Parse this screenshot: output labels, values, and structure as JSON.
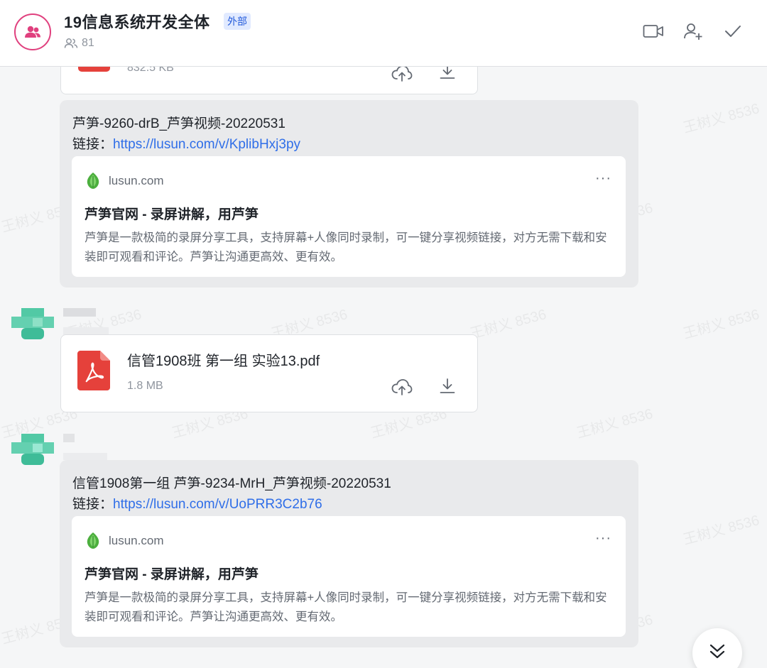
{
  "header": {
    "group_name": "19信息系统开发全体",
    "tag": "外部",
    "member_count": "81"
  },
  "icons": {
    "group_avatar": "group-icon",
    "video_call": "video-camera-icon",
    "add_member": "add-member-icon",
    "done": "checkmark-icon",
    "scroll": "double-chevron-down-icon"
  },
  "colors": {
    "avatar_accent": "#e0407e",
    "link": "#2f6ee8",
    "pdf": "#e5413b",
    "tag_bg": "#e1eaff",
    "tag_text": "#245bdb"
  },
  "messages": {
    "top_file": {
      "size": "832.5 KB"
    },
    "link_msg_1": {
      "title_line": "芦笋-9260-drB_芦笋视频-20220531",
      "link_label": "链接：",
      "url": "https://lusun.com/v/KplibHxj3py",
      "preview": {
        "site": "lusun.com",
        "more": "···",
        "title": "芦笋官网 - 录屏讲解，用芦笋",
        "description": "芦笋是一款极简的录屏分享工具，支持屏幕+人像同时录制，可一键分享视频链接，对方无需下载和安装即可观看和评论。芦笋让沟通更高效、更有效。"
      }
    },
    "file_msg": {
      "name": "信管1908班 第一组 实验13.pdf",
      "size": "1.8 MB"
    },
    "link_msg_2": {
      "title_line": "信管1908第一组 芦笋-9234-MrH_芦笋视频-20220531",
      "link_label": "链接：",
      "url": "https://lusun.com/v/UoPRR3C2b76",
      "preview": {
        "site": "lusun.com",
        "more": "···",
        "title": "芦笋官网 - 录屏讲解，用芦笋",
        "description": "芦笋是一款极简的录屏分享工具，支持屏幕+人像同时录制，可一键分享视频链接，对方无需下载和安装即可观看和评论。芦笋让沟通更高效、更有效。"
      }
    }
  },
  "watermark": "王树义 8536"
}
